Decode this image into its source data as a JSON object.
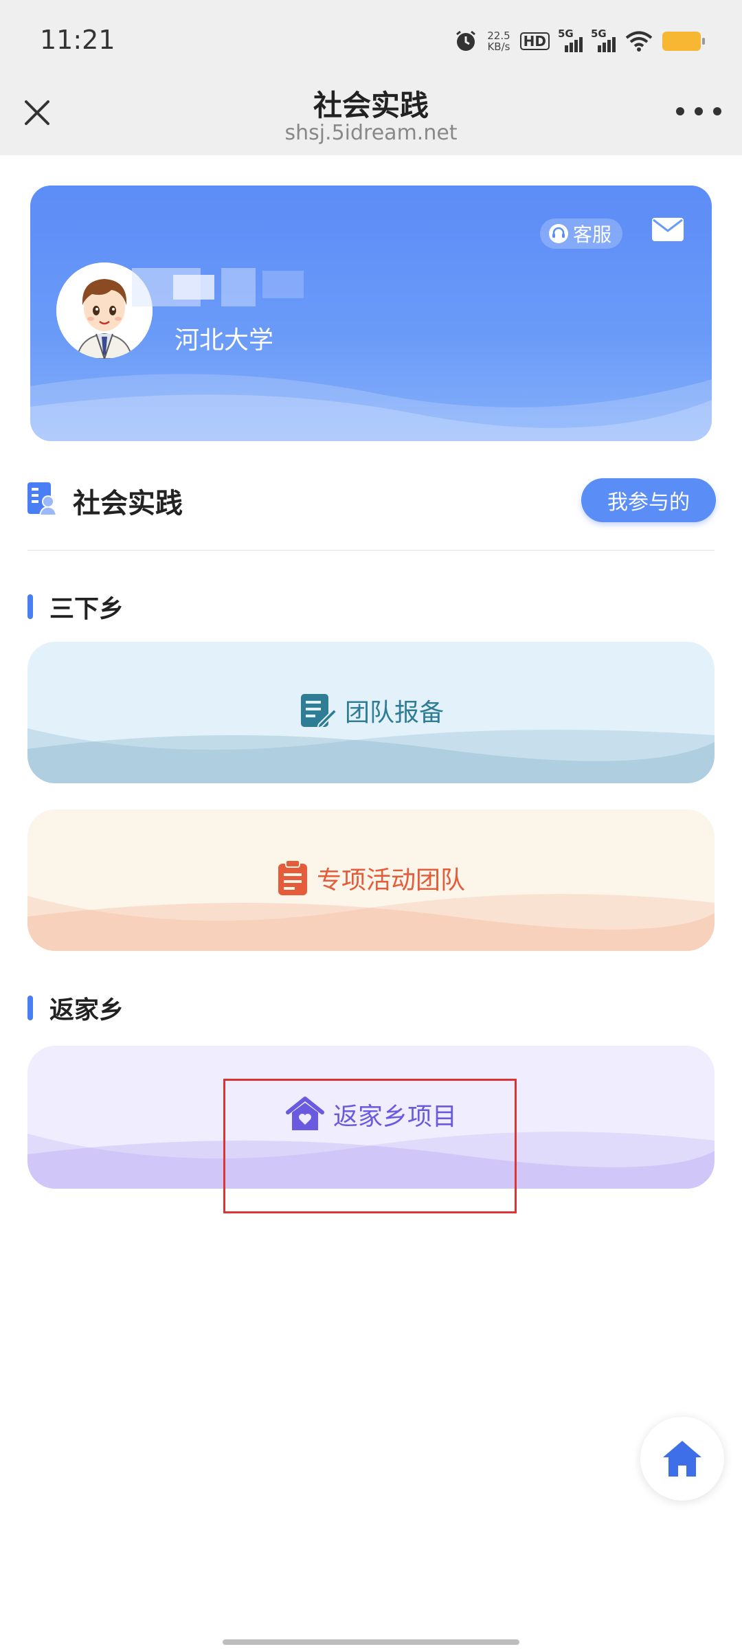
{
  "status_bar": {
    "time": "11:21",
    "net_speed_value": "22.5",
    "net_speed_unit": "KB/s",
    "hd_label": "HD",
    "signal_1_label": "5G",
    "signal_2_label": "5G",
    "icons": [
      "alarm-icon",
      "hd-icon",
      "signal-icon",
      "signal-icon",
      "wifi-icon",
      "battery-icon"
    ]
  },
  "nav": {
    "title": "社会实践",
    "url": "shsj.5idream.net",
    "icons": [
      "close-icon",
      "more-icon"
    ]
  },
  "profile": {
    "customer_service_label": "客服",
    "school": "河北大学",
    "icons": [
      "headset-icon",
      "mail-icon",
      "avatar"
    ]
  },
  "section": {
    "title": "社会实践",
    "my_participation_label": "我参与的",
    "icon": "document-person-icon"
  },
  "groups": [
    {
      "title": "三下乡",
      "cards": [
        {
          "label": "团队报备",
          "icon": "edit-note-icon",
          "accent": "#2e7d95"
        },
        {
          "label": "专项活动团队",
          "icon": "clipboard-icon",
          "accent": "#e45c3a"
        }
      ]
    },
    {
      "title": "返家乡",
      "cards": [
        {
          "label": "返家乡项目",
          "icon": "house-heart-icon",
          "accent": "#6a5ae0"
        }
      ]
    }
  ],
  "fab": {
    "icon": "home-icon",
    "accent": "#3f6fe8"
  },
  "colors": {
    "primary": "#5b8df6",
    "profile_bg": "#6b9bf8",
    "highlight": "#dd3333"
  }
}
